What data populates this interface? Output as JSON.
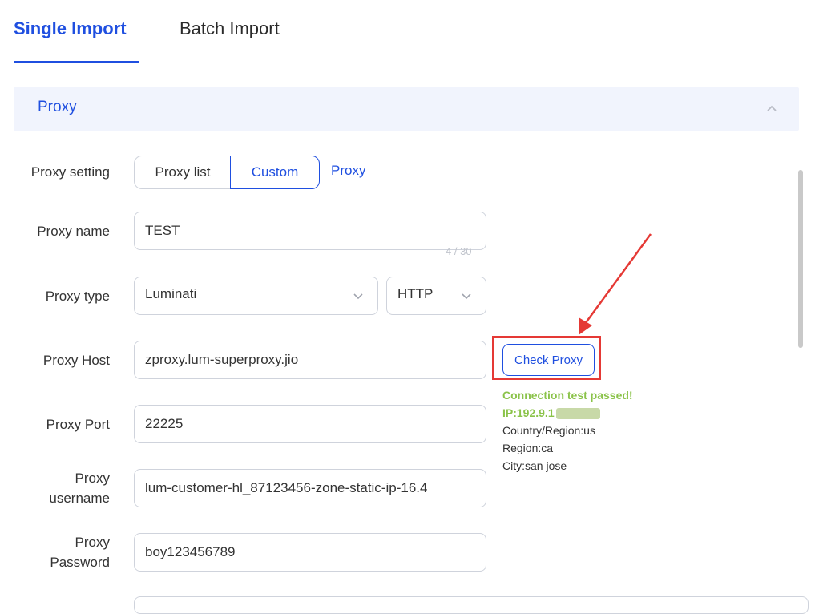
{
  "tabs": {
    "single": "Single Import",
    "batch": "Batch Import"
  },
  "panel": {
    "title": "Proxy"
  },
  "form": {
    "proxy_setting": {
      "label": "Proxy setting",
      "option_list": "Proxy list",
      "option_custom": "Custom",
      "link": "Proxy"
    },
    "proxy_name": {
      "label": "Proxy name",
      "value": "TEST",
      "counter": "4 / 30"
    },
    "proxy_type": {
      "label": "Proxy type",
      "provider": "Luminati",
      "protocol": "HTTP"
    },
    "proxy_host": {
      "label": "Proxy Host",
      "value": "zproxy.lum-superproxy.jio"
    },
    "proxy_port": {
      "label": "Proxy Port",
      "value": "22225"
    },
    "proxy_username": {
      "label_1": "Proxy",
      "label_2": "username",
      "value": "lum-customer-hl_87123456-zone-static-ip-16.4"
    },
    "proxy_password": {
      "label_1": "Proxy",
      "label_2": "Password",
      "value": "boy123456789"
    }
  },
  "check": {
    "button": "Check Proxy",
    "status": "Connection test passed!",
    "ip": "IP:192.9.1",
    "country": "Country/Region:us",
    "region": "Region:ca",
    "city": "City:san jose"
  },
  "colors": {
    "accent": "#1f4fe0",
    "success": "#8bc34a",
    "highlight": "#e53935"
  }
}
